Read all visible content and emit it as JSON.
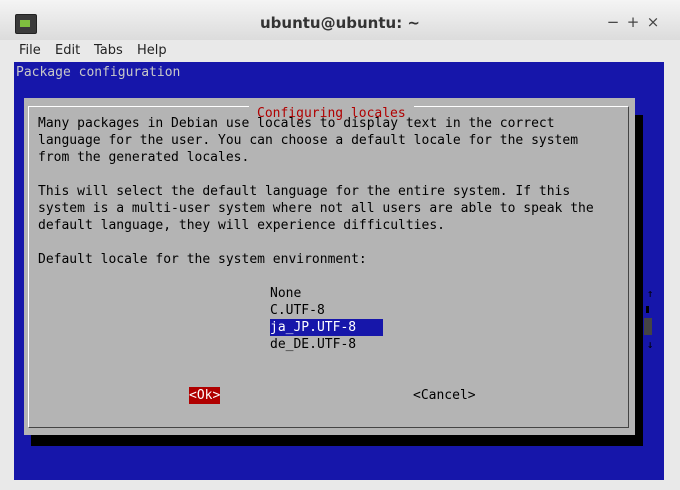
{
  "window": {
    "title": "ubuntu@ubuntu: ~",
    "minimize": "−",
    "maximize": "+",
    "close": "×"
  },
  "menubar": {
    "items": [
      "File",
      "Edit",
      "Tabs",
      "Help"
    ]
  },
  "terminal": {
    "package_configuration": "Package configuration",
    "dialog": {
      "title": "Configuring locales",
      "paragraph1": [
        "Many packages in Debian use locales to display text in the correct",
        "language for the user. You can choose a default locale for the system",
        "from the generated locales."
      ],
      "paragraph2": [
        "This will select the default language for the entire system. If this",
        "system is a multi-user system where not all users are able to speak the",
        "default language, they will experience difficulties."
      ],
      "prompt": "Default locale for the system environment:",
      "options": [
        "None",
        "C.UTF-8",
        "ja_JP.UTF-8",
        "de_DE.UTF-8"
      ],
      "selected": "ja_JP.UTF-8",
      "ok_button": "<Ok>",
      "cancel_button": "<Cancel>",
      "scroll_up": "↑",
      "scroll_down": "↓"
    }
  },
  "colors": {
    "terminal_bg": "#1616aa",
    "dialog_bg": "#b4b4b4",
    "accent_red": "#b00000"
  }
}
